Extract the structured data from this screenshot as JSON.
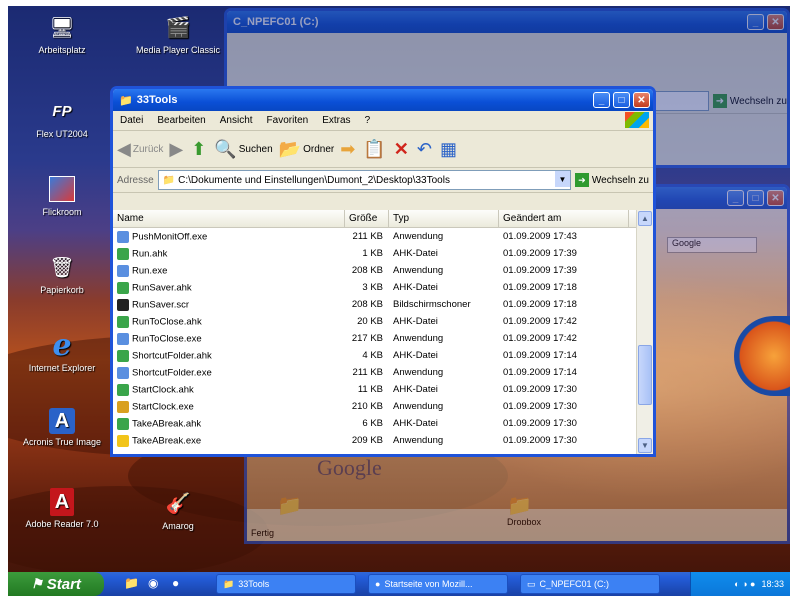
{
  "desktop_icons": [
    {
      "label": "Arbeitsplatz",
      "glyph": "🖥"
    },
    {
      "label": "Media Player Classic",
      "glyph": "🎬"
    },
    {
      "label": "Flex UT2004",
      "glyph": "FP"
    },
    {
      "label": "Flickroom"
    },
    {
      "label": "Papierkorb",
      "glyph": "🗑"
    },
    {
      "label": "Internet Explorer",
      "glyph": "e"
    },
    {
      "label": "Acronis True Image",
      "glyph": "A"
    },
    {
      "label": "Adobe Reader 7.0",
      "glyph": "A"
    },
    {
      "label": "Amarog",
      "glyph": "🎸"
    }
  ],
  "bg_window_1": {
    "title": "C_NPEFC01 (C:)",
    "addr_go": "Wechseln zu"
  },
  "bg_window_2": {
    "search_placeholder": "Google",
    "google": "Google",
    "folder_label": "Dropbox",
    "status": "Fertig"
  },
  "explorer": {
    "title": "33Tools",
    "menu": [
      "Datei",
      "Bearbeiten",
      "Ansicht",
      "Favoriten",
      "Extras",
      "?"
    ],
    "toolbar": {
      "back": "Zurück",
      "search": "Suchen",
      "folders": "Ordner"
    },
    "address": {
      "label": "Adresse",
      "path": "C:\\Dokumente und Einstellungen\\Dumont_2\\Desktop\\33Tools",
      "go": "Wechseln zu"
    },
    "columns": {
      "name": "Name",
      "size": "Größe",
      "type": "Typ",
      "modified": "Geändert am"
    },
    "files": [
      {
        "name": "PushMonitOff.exe",
        "size": "211 KB",
        "type": "Anwendung",
        "date": "01.09.2009 17:43",
        "icon": "exe"
      },
      {
        "name": "Run.ahk",
        "size": "1 KB",
        "type": "AHK-Datei",
        "date": "01.09.2009 17:39",
        "icon": "ahk"
      },
      {
        "name": "Run.exe",
        "size": "208 KB",
        "type": "Anwendung",
        "date": "01.09.2009 17:39",
        "icon": "exe"
      },
      {
        "name": "RunSaver.ahk",
        "size": "3 KB",
        "type": "AHK-Datei",
        "date": "01.09.2009 17:18",
        "icon": "ahk"
      },
      {
        "name": "RunSaver.scr",
        "size": "208 KB",
        "type": "Bildschirmschoner",
        "date": "01.09.2009 17:18",
        "icon": "scr"
      },
      {
        "name": "RunToClose.ahk",
        "size": "20 KB",
        "type": "AHK-Datei",
        "date": "01.09.2009 17:42",
        "icon": "ahk"
      },
      {
        "name": "RunToClose.exe",
        "size": "217 KB",
        "type": "Anwendung",
        "date": "01.09.2009 17:42",
        "icon": "exe"
      },
      {
        "name": "ShortcutFolder.ahk",
        "size": "4 KB",
        "type": "AHK-Datei",
        "date": "01.09.2009 17:14",
        "icon": "ahk"
      },
      {
        "name": "ShortcutFolder.exe",
        "size": "211 KB",
        "type": "Anwendung",
        "date": "01.09.2009 17:14",
        "icon": "exe"
      },
      {
        "name": "StartClock.ahk",
        "size": "11 KB",
        "type": "AHK-Datei",
        "date": "01.09.2009 17:30",
        "icon": "ahk"
      },
      {
        "name": "StartClock.exe",
        "size": "210 KB",
        "type": "Anwendung",
        "date": "01.09.2009 17:30",
        "icon": "clock"
      },
      {
        "name": "TakeABreak.ahk",
        "size": "6 KB",
        "type": "AHK-Datei",
        "date": "01.09.2009 17:30",
        "icon": "ahk"
      },
      {
        "name": "TakeABreak.exe",
        "size": "209 KB",
        "type": "Anwendung",
        "date": "01.09.2009 17:30",
        "icon": "break"
      }
    ]
  },
  "taskbar": {
    "start": "Start",
    "tasks": [
      "33Tools",
      "Startseite von Mozill...",
      "C_NPEFC01 (C:)"
    ],
    "clock": "18:33"
  },
  "colors": {
    "titlebar": "#0a4fd6",
    "start": "#2f8a2f",
    "taskbar": "#245edb"
  }
}
